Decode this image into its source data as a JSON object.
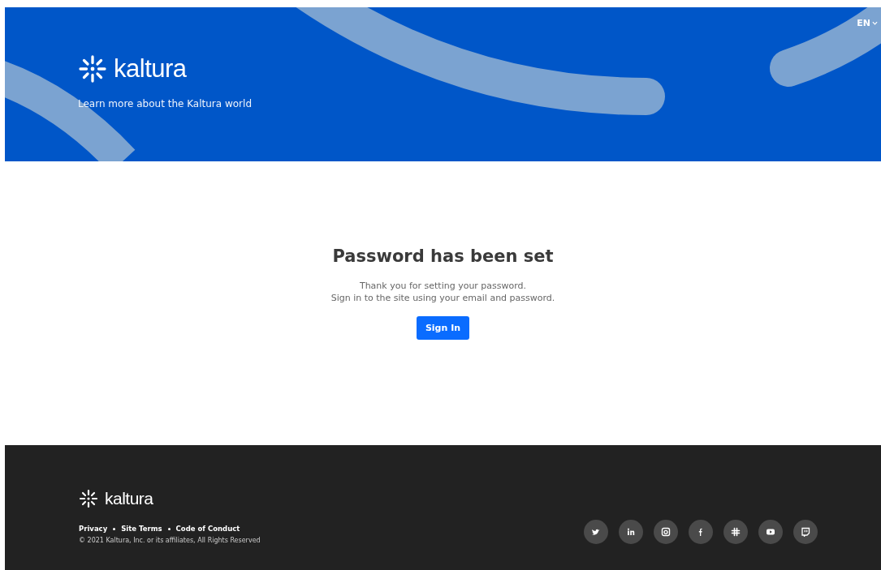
{
  "header": {
    "logo_text": "kaltura",
    "tagline": "Learn more about the Kaltura world",
    "language": "EN"
  },
  "main": {
    "title": "Password has been set",
    "lines": [
      "Thank you for setting your password.",
      "Sign in to the site using your email and password."
    ],
    "button": "Sign In"
  },
  "footer": {
    "logo_text": "kaltura",
    "links": [
      "Privacy",
      "Site Terms",
      "Code of Conduct"
    ],
    "copyright": "© 2021 Kaltura, Inc. or its affiliates, All Rights Reserved",
    "social": [
      {
        "kind": "twitter"
      },
      {
        "kind": "linkedin"
      },
      {
        "kind": "instagram"
      },
      {
        "kind": "facebook"
      },
      {
        "kind": "slack"
      },
      {
        "kind": "youtube"
      },
      {
        "kind": "twitch"
      }
    ]
  }
}
